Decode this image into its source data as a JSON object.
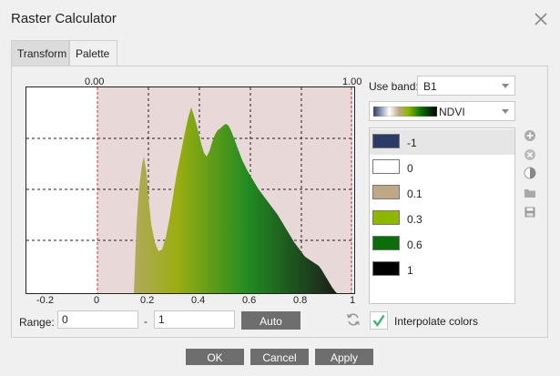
{
  "window": {
    "title": "Raster Calculator"
  },
  "tabs": [
    {
      "label": "Transform",
      "active": false
    },
    {
      "label": "Palette",
      "active": true
    }
  ],
  "histogram": {
    "range_start_label": "0.00",
    "range_end_label": "1.00",
    "x_tick_labels": [
      "-0.2",
      "0",
      "0.2",
      "0.4",
      "0.6",
      "0.8",
      "1"
    ]
  },
  "range": {
    "label": "Range:",
    "min_value": "0",
    "separator": "-",
    "max_value": "1",
    "auto_label": "Auto"
  },
  "band": {
    "label": "Use band:",
    "value": "B1"
  },
  "palette_select": {
    "value": "NDVI"
  },
  "palette_items": [
    {
      "label": "-1",
      "color": "#2c3a66",
      "selected": true
    },
    {
      "label": "0",
      "color": "#ffffff",
      "selected": false
    },
    {
      "label": "0.1",
      "color": "#bfa886",
      "selected": false
    },
    {
      "label": "0.3",
      "color": "#8db600",
      "selected": false
    },
    {
      "label": "0.6",
      "color": "#0b6e0b",
      "selected": false
    },
    {
      "label": "1",
      "color": "#000000",
      "selected": false
    }
  ],
  "interpolate": {
    "label": "Interpolate colors",
    "checked": true
  },
  "buttons": {
    "ok": "OK",
    "cancel": "Cancel",
    "apply": "Apply"
  },
  "colors": {
    "accent": "#6e6e6e",
    "check": "#3cb371",
    "range_fill": "#e8d8d8",
    "range_line": "#cc3333"
  }
}
